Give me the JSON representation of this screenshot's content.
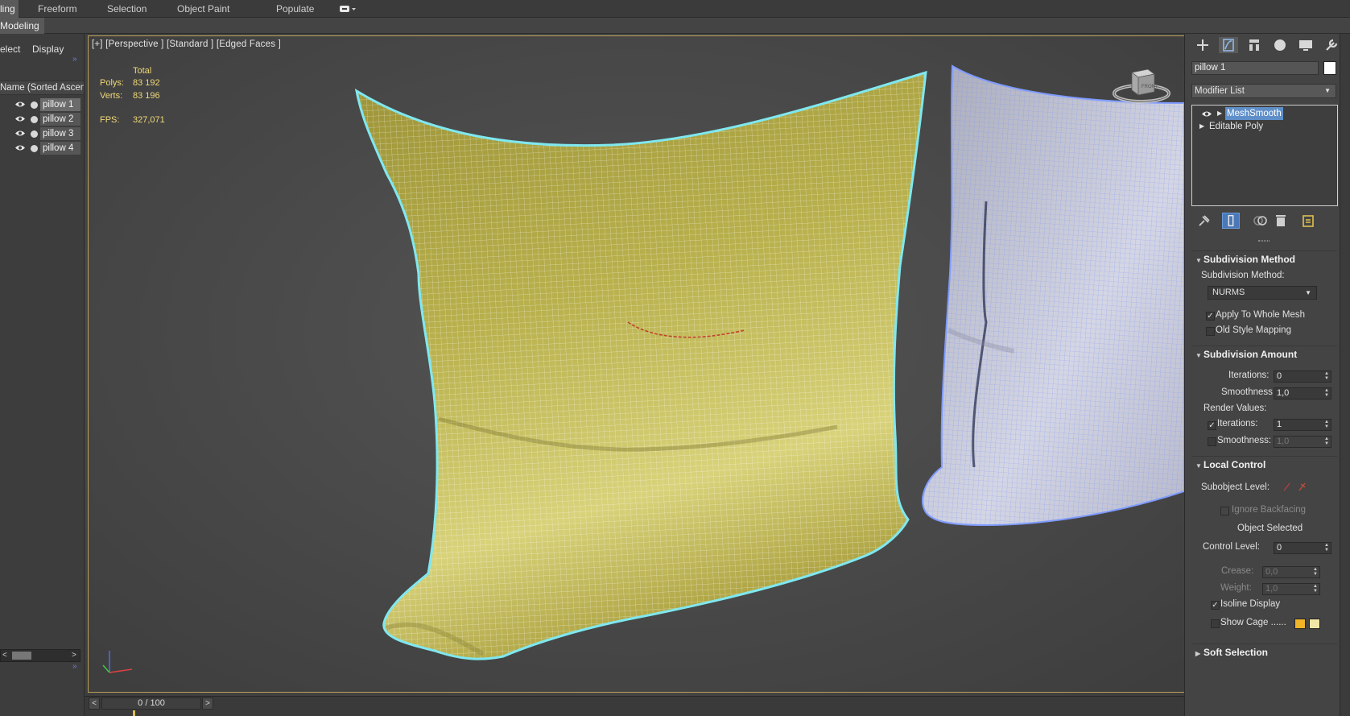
{
  "ribbon": {
    "tabs": [
      "ling",
      "Freeform",
      "Selection",
      "Object Paint",
      "Populate"
    ],
    "sub_tab": "Modeling"
  },
  "explorer": {
    "menu": [
      "elect",
      "Display"
    ],
    "column_header": "Name (Sorted Ascen",
    "items": [
      {
        "label": "pillow 1"
      },
      {
        "label": "pillow 2"
      },
      {
        "label": "pillow 3"
      },
      {
        "label": "pillow 4"
      }
    ]
  },
  "viewport": {
    "label": "[+] [Perspective ] [Standard ] [Edged Faces ]",
    "stats": {
      "total_label": "Total",
      "polys_label": "Polys:",
      "polys_value": "83 192",
      "verts_label": "Verts:",
      "verts_value": "83 196",
      "fps_label": "FPS:",
      "fps_value": "327,071"
    },
    "navcube_label": "FRONT"
  },
  "timeslider": {
    "frame": "0 / 100",
    "prev": "<",
    "next": ">",
    "current_frame": 0,
    "total_frames": 100
  },
  "command_panel": {
    "tab_icons": [
      "create-icon",
      "modify-icon",
      "hierarchy-icon",
      "motion-icon",
      "display-icon",
      "utilities-icon"
    ],
    "object_name": "pillow 1",
    "object_color": "#ffffff",
    "modifier_list": "Modifier List",
    "stack": [
      {
        "label": "MeshSmooth",
        "selected": true
      },
      {
        "label": "Editable Poly",
        "selected": false
      }
    ],
    "subdivision_method": {
      "title": "Subdivision Method",
      "method_label": "Subdivision Method:",
      "method_value": "NURMS",
      "apply_whole_mesh": "Apply To Whole Mesh",
      "old_style_mapping": "Old Style Mapping"
    },
    "subdivision_amount": {
      "title": "Subdivision Amount",
      "iterations_label": "Iterations:",
      "iterations_value": "0",
      "smoothness_label": "Smoothness:",
      "smoothness_value": "1,0",
      "render_values_label": "Render Values:",
      "render_iterations_label": "Iterations:",
      "render_iterations_value": "1",
      "render_smoothness_label": "Smoothness:",
      "render_smoothness_value": "1,0"
    },
    "local_control": {
      "title": "Local Control",
      "subobject_label": "Subobject Level:",
      "ignore_backfacing": "Ignore Backfacing",
      "object_selected": "Object Selected",
      "control_level_label": "Control Level:",
      "control_level_value": "0",
      "crease_label": "Crease:",
      "crease_value": "0,0",
      "weight_label": "Weight:",
      "weight_value": "1,0",
      "isoline_display": "Isoline Display",
      "show_cage": "Show Cage ......",
      "cage_color_1": "#f0b429",
      "cage_color_2": "#f0e7a6"
    },
    "soft_selection": {
      "title": "Soft Selection"
    }
  },
  "colors": {
    "selection_outline": "#7fe8f0",
    "pillow_selected": "#c8c060",
    "pillow_other": "#c8cbdb",
    "wire_other": "#7f9bff",
    "stats_text": "#f0d878"
  }
}
